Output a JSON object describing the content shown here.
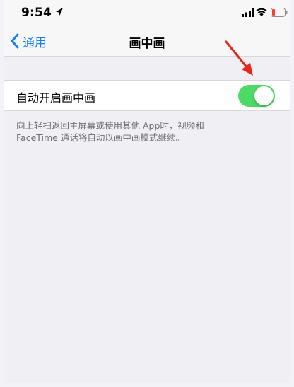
{
  "status_bar": {
    "time": "9:54",
    "icons": [
      "location-arrow-icon",
      "signal-icon",
      "wifi-icon",
      "battery-low-icon"
    ]
  },
  "nav": {
    "back_label": "通用",
    "title": "画中画"
  },
  "setting": {
    "label": "自动开启画中画",
    "enabled": true
  },
  "footer": {
    "line1": "向上轻扫返回主屏幕或使用其他 App时，视频和",
    "line2": "FaceTime 通话将自动以画中画模式继续。"
  },
  "colors": {
    "accent": "#147efb",
    "toggle_on": "#4cd964",
    "battery_low": "#ff3b30",
    "annotation_arrow": "#e8261e"
  }
}
